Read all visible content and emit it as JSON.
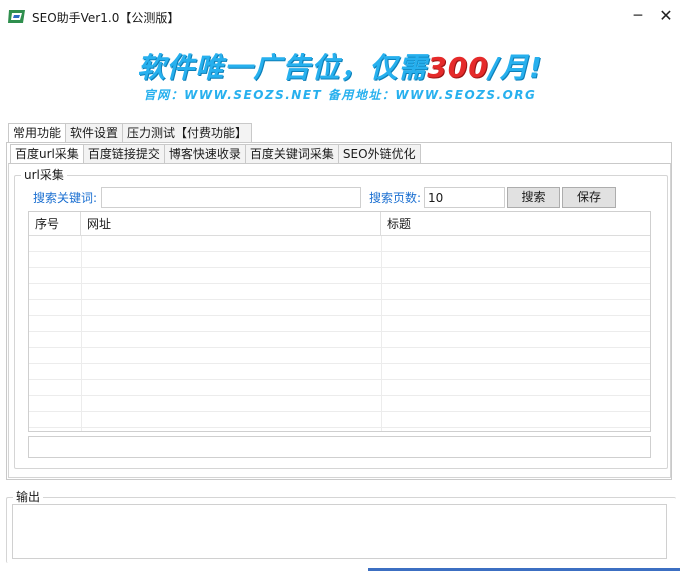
{
  "window": {
    "title": "SEO助手Ver1.0【公测版】",
    "minimize_glyph": "─",
    "close_glyph": "✕"
  },
  "banner": {
    "headline_pre": "软件唯一广告位，仅需",
    "headline_price": "300",
    "headline_post": "/月!",
    "subline": "官网：WWW.SEOZS.NET 备用地址：WWW.SEOZS.ORG"
  },
  "main_tabs": [
    {
      "label": "常用功能",
      "active": true
    },
    {
      "label": "软件设置",
      "active": false
    },
    {
      "label": "压力测试【付费功能】",
      "active": false
    }
  ],
  "sub_tabs": [
    {
      "label": "百度url采集",
      "active": true
    },
    {
      "label": "百度链接提交",
      "active": false
    },
    {
      "label": "博客快速收录",
      "active": false
    },
    {
      "label": "百度关键词采集",
      "active": false
    },
    {
      "label": "SEO外链优化",
      "active": false
    }
  ],
  "url_group": {
    "legend": "url采集",
    "keyword_label": "搜索关键词:",
    "keyword_value": "",
    "pages_label": "搜索页数:",
    "pages_value": "10",
    "search_button": "搜索",
    "save_button": "保存"
  },
  "table": {
    "columns": [
      "序号",
      "网址",
      "标题"
    ],
    "rows": []
  },
  "output_group": {
    "legend": "输出",
    "text": ""
  },
  "colors": {
    "banner_blue": "#27b0ee",
    "banner_red": "#e52a2a",
    "label_blue": "#1a6fd1"
  }
}
